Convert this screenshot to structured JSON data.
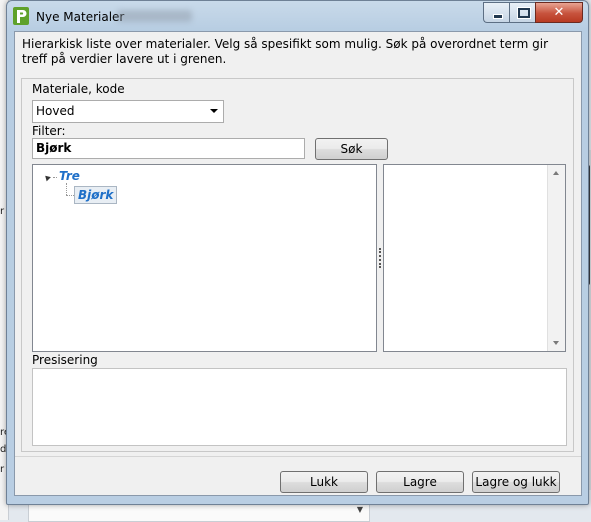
{
  "window": {
    "title": "Nye Materialer",
    "description": "Hierarkisk liste over materialer. Velg så spesifikt som mulig. Søk på overordnet term gir treff på verdier lavere ut i grenen."
  },
  "form": {
    "material_label": "Materiale, kode",
    "material_selected": "Hoved",
    "filter_label": "Filter:",
    "filter_value": "Bjørk",
    "search_button": "Søk",
    "presisering_label": "Presisering",
    "presisering_value": ""
  },
  "tree": {
    "root": "Tre",
    "child": "Bjørk"
  },
  "buttons": {
    "close": "Lukk",
    "save": "Lagre",
    "save_close": "Lagre og lukk"
  },
  "colors": {
    "accent": "#1e6fc8",
    "titlebar": "#b9cee3",
    "close_button": "#c7533d",
    "app_icon": "#5fa12a"
  },
  "icons": {
    "app": "green-p-logo-icon",
    "minimize": "minimize-icon",
    "maximize": "maximize-icon",
    "close": "close-icon"
  }
}
